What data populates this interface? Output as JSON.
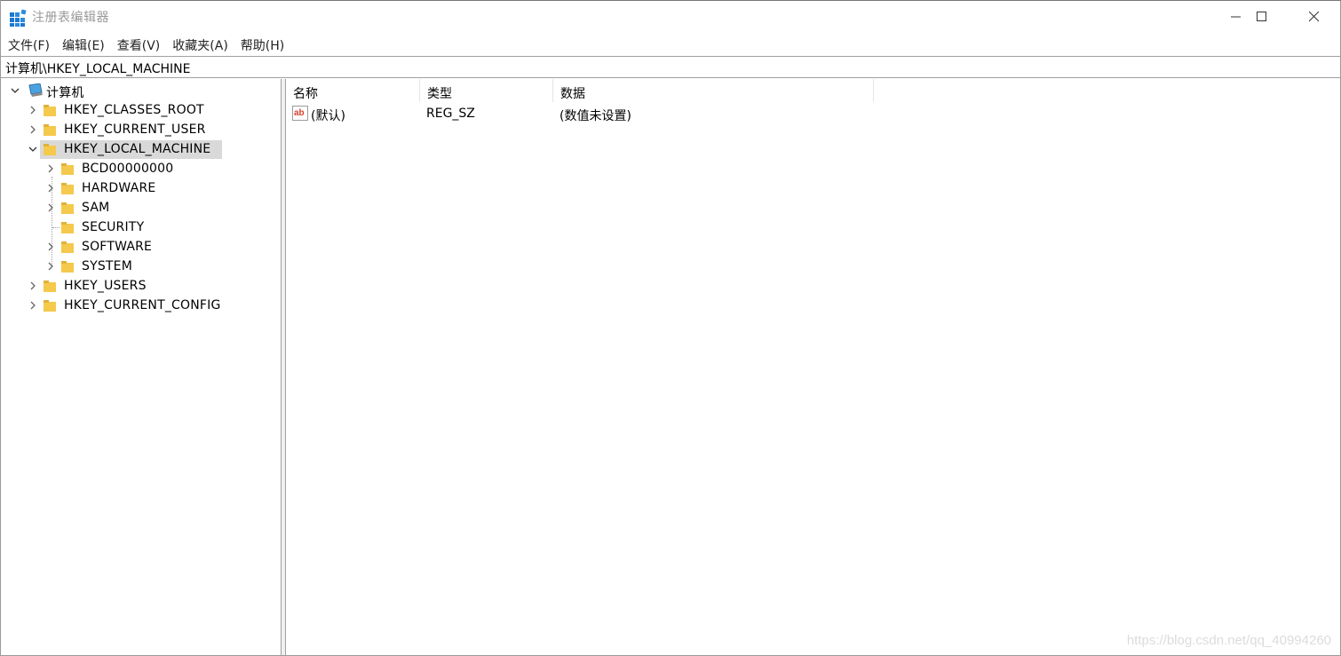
{
  "window": {
    "title": "注册表编辑器"
  },
  "menu": [
    {
      "label": "文件(F)"
    },
    {
      "label": "编辑(E)"
    },
    {
      "label": "查看(V)"
    },
    {
      "label": "收藏夹(A)"
    },
    {
      "label": "帮助(H)"
    }
  ],
  "address": {
    "path": "计算机\\HKEY_LOCAL_MACHINE"
  },
  "tree": {
    "root": "计算机",
    "items": [
      {
        "label": "HKEY_CLASSES_ROOT",
        "expanded": false
      },
      {
        "label": "HKEY_CURRENT_USER",
        "expanded": false
      },
      {
        "label": "HKEY_LOCAL_MACHINE",
        "expanded": true,
        "selected": true,
        "children": [
          {
            "label": "BCD00000000",
            "has_children": true
          },
          {
            "label": "HARDWARE",
            "has_children": true
          },
          {
            "label": "SAM",
            "has_children": true
          },
          {
            "label": "SECURITY",
            "has_children": false
          },
          {
            "label": "SOFTWARE",
            "has_children": true
          },
          {
            "label": "SYSTEM",
            "has_children": true
          }
        ]
      },
      {
        "label": "HKEY_USERS",
        "expanded": false
      },
      {
        "label": "HKEY_CURRENT_CONFIG",
        "expanded": false
      }
    ]
  },
  "list": {
    "columns": [
      "名称",
      "类型",
      "数据"
    ],
    "rows": [
      {
        "name": "(默认)",
        "type": "REG_SZ",
        "data": "(数值未设置)",
        "icon": "string-value-icon"
      }
    ]
  },
  "watermark": "https://blog.csdn.net/qq_40994260",
  "colors": {
    "selection": "#d9d9d9",
    "folder": "#f4c94c",
    "border": "#a0a0a0"
  }
}
